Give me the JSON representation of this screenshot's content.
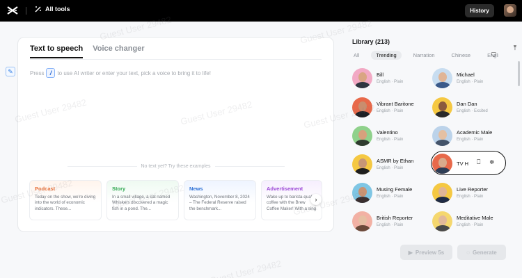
{
  "topbar": {
    "tools_label": "All tools",
    "history_label": "History"
  },
  "editor": {
    "tabs": [
      {
        "label": "Text to speech"
      },
      {
        "label": "Voice changer"
      }
    ],
    "prompt_before": "Press",
    "prompt_key": "/",
    "prompt_after": "to use AI writer or enter your text, pick a voice to bring it to life!",
    "examples_title": "No text yet? Try these examples",
    "examples": [
      {
        "title": "Podcast",
        "text": "Today on the show, we're diving into the world of economic indicators. These...",
        "color": "#e8713a"
      },
      {
        "title": "Story",
        "text": "In a small village, a cat named Whiskers discovered a magic fish in a pond. The...",
        "color": "#2ea74f"
      },
      {
        "title": "News",
        "text": "Washington, November 8, 2024 – The Federal Reserve raised the benchmark...",
        "color": "#2b6fd6"
      },
      {
        "title": "Advertisement",
        "text": "Wake up to barista-quality coffee with the Brew Coffee Maker! With a sing",
        "color": "#9b45d6"
      }
    ]
  },
  "library": {
    "title": "Library (213)",
    "chips": [
      "All",
      "Trending",
      "Narration",
      "Chinese",
      "English"
    ],
    "active_chip": "Trending",
    "voices": [
      {
        "name": "Bill",
        "meta": "English · Plain"
      },
      {
        "name": "Michael",
        "meta": "English · Plain"
      },
      {
        "name": "Vibrant Baritone",
        "meta": "English · Plain"
      },
      {
        "name": "Dan Dan",
        "meta": "English · Excited"
      },
      {
        "name": "Valentino",
        "meta": "English · Plain"
      },
      {
        "name": "Academic Male",
        "meta": "English · Plain"
      },
      {
        "name": "ASMR by Ethan",
        "meta": "English · Plain"
      },
      {
        "name": "TV H",
        "meta": ""
      },
      {
        "name": "Musing Female",
        "meta": "English · Plain"
      },
      {
        "name": "Live Reporter",
        "meta": "English · Plain"
      },
      {
        "name": "British Reporter",
        "meta": "English · Plain"
      },
      {
        "name": "Meditative Male",
        "meta": "English · Plain"
      }
    ]
  },
  "actions": {
    "preview_label": "Preview 5s",
    "generate_label": "Generate"
  },
  "watermark": "Guest User 29482"
}
